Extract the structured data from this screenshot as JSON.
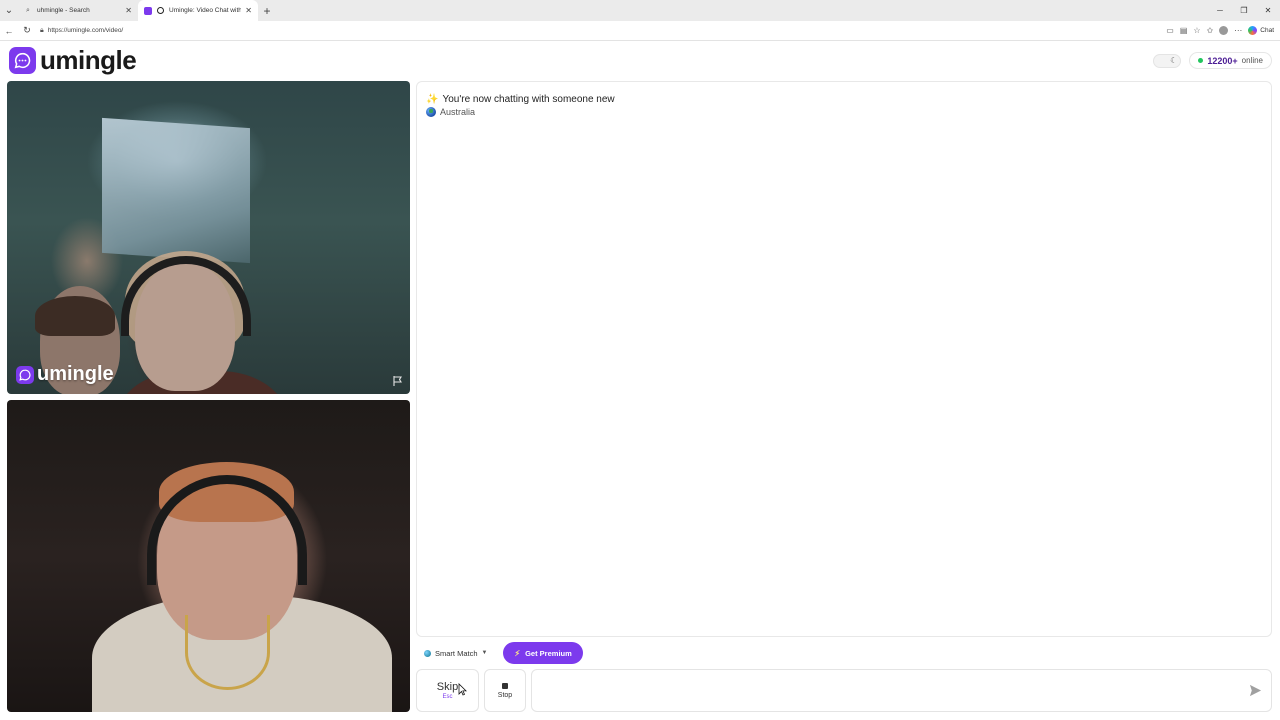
{
  "browser": {
    "tabs": [
      {
        "title": "uhmingle - Search",
        "active": false
      },
      {
        "title": "Umingle: Video Chat with Str",
        "active": true
      }
    ],
    "url": "https://umingle.com/video/",
    "copilot_label": "Chat"
  },
  "header": {
    "logo_text": "umingle",
    "online_count": "12200+",
    "online_label": "online"
  },
  "video": {
    "watermark": "umingle"
  },
  "chat": {
    "system_message": "You're now chatting with someone new",
    "country": "Australia",
    "input_value": ""
  },
  "controls": {
    "smart_match_label": "Smart Match",
    "premium_label": "Get Premium",
    "skip_label": "Skip",
    "skip_hint": "Esc",
    "stop_label": "Stop"
  },
  "colors": {
    "brand": "#7c3aed",
    "online": "#22c55e"
  }
}
